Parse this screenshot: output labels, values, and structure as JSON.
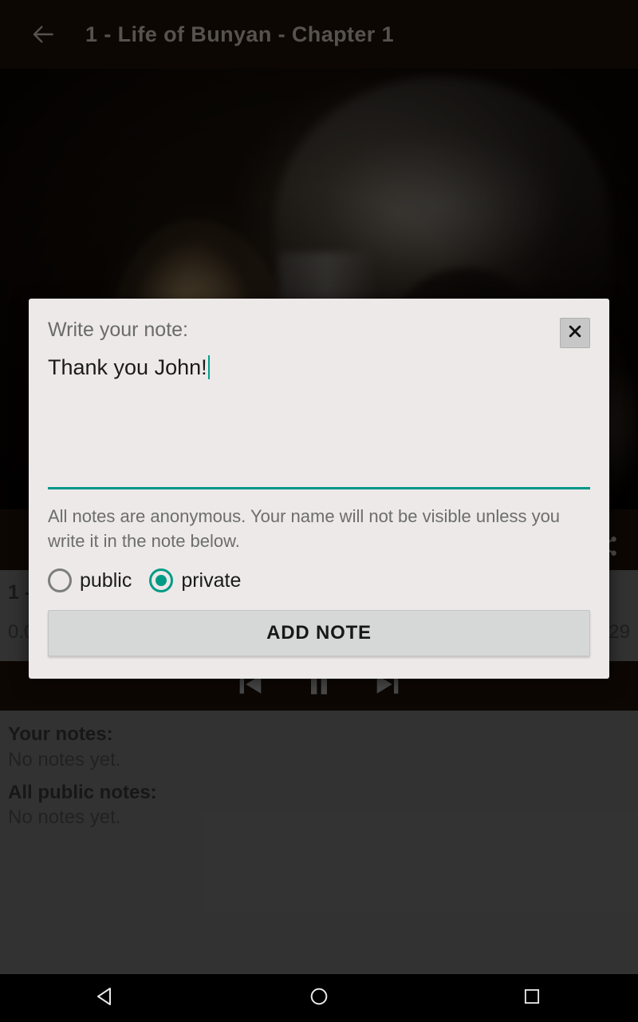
{
  "appbar": {
    "back_icon": "arrow-left-icon",
    "title": "1 - Life of Bunyan - Chapter 1"
  },
  "artwork": {
    "alt": "dark-classical-painting"
  },
  "player": {
    "share_icon": "share-icon",
    "track_title": "1 -",
    "time_start": "0.0",
    "time_end": "29",
    "previous_icon": "skip-previous-icon",
    "pause_icon": "pause-icon",
    "next_icon": "skip-next-icon"
  },
  "notes_panel": {
    "your_notes_heading": "Your notes:",
    "your_notes_empty": "No notes yet.",
    "public_notes_heading": "All public notes:",
    "public_notes_empty": "No notes yet."
  },
  "dialog": {
    "title": "Write your note:",
    "close_icon": "close-icon",
    "note_value": "Thank you John!",
    "note_placeholder": "",
    "anonymous_notice": "All notes are anonymous. Your name will not be visible unless you write it in the note below.",
    "visibility": {
      "selected": "private",
      "options": [
        {
          "id": "public",
          "label": "public",
          "selected": false
        },
        {
          "id": "private",
          "label": "private",
          "selected": true
        }
      ]
    },
    "submit_label": "ADD NOTE"
  },
  "navbar": {
    "back_icon": "triangle-back-icon",
    "home_icon": "circle-home-icon",
    "recents_icon": "square-recents-icon"
  },
  "colors": {
    "accent_teal": "#009688",
    "appbar_bg": "#190e06",
    "dialog_bg": "#ece9e8",
    "panel_gray": "#5c5c5c",
    "title_text": "#9d958e"
  }
}
